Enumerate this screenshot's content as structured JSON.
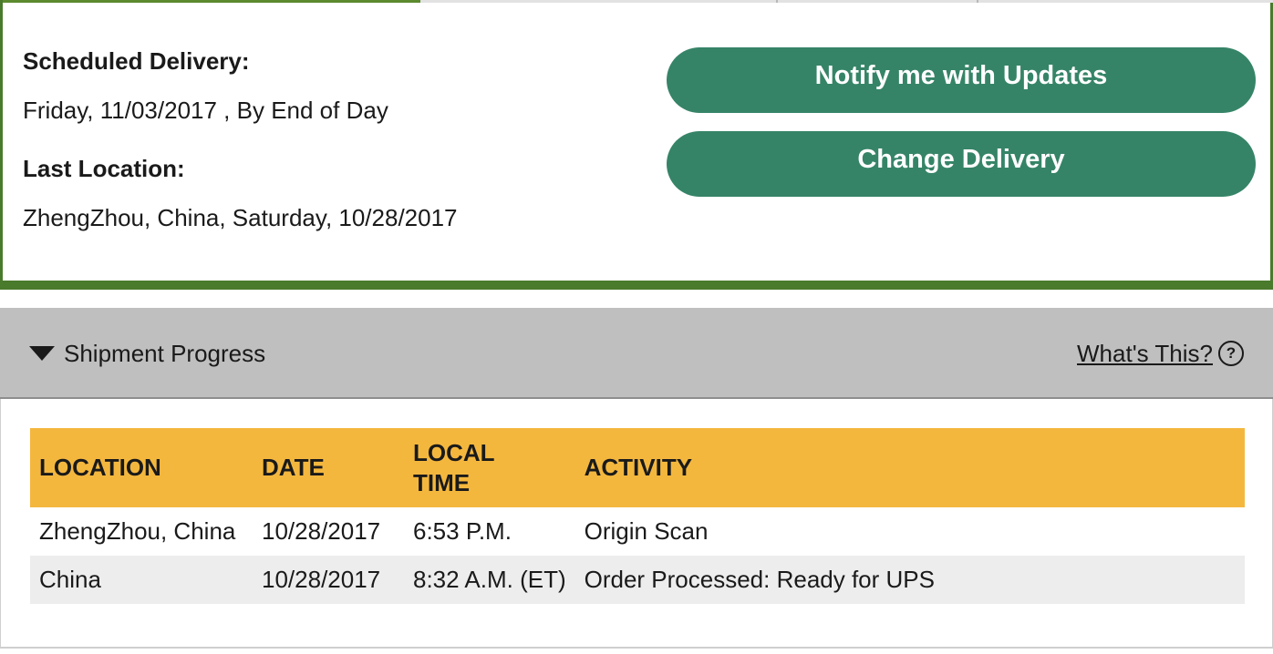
{
  "delivery": {
    "scheduled_label": "Scheduled Delivery:",
    "scheduled_value": "Friday, 11/03/2017 , By End of Day",
    "last_location_label": "Last Location:",
    "last_location_value": "ZhengZhou, China, Saturday, 10/28/2017"
  },
  "actions": {
    "notify_label": "Notify me with Updates",
    "change_label": "Change Delivery"
  },
  "progress": {
    "title": "Shipment Progress",
    "help_link": "What's This?",
    "help_icon": "?",
    "columns": {
      "location": "LOCATION",
      "date": "DATE",
      "local_time_line1": "LOCAL",
      "local_time_line2": "TIME",
      "activity": "ACTIVITY"
    },
    "rows": [
      {
        "location": "ZhengZhou,  China",
        "date": "10/28/2017",
        "time": "6:53 P.M.",
        "activity": "Origin Scan"
      },
      {
        "location": "China",
        "date": "10/28/2017",
        "time": "8:32 A.M. (ET)",
        "activity": "Order Processed: Ready for UPS"
      }
    ]
  },
  "colors": {
    "brand_green_border": "#4a7a2c",
    "button_green": "#368468",
    "table_header_gold": "#f4b73e",
    "section_header_gray": "#bfbfbf"
  },
  "icons": {
    "caret": "caret-down-icon",
    "help": "help-circle-icon"
  }
}
